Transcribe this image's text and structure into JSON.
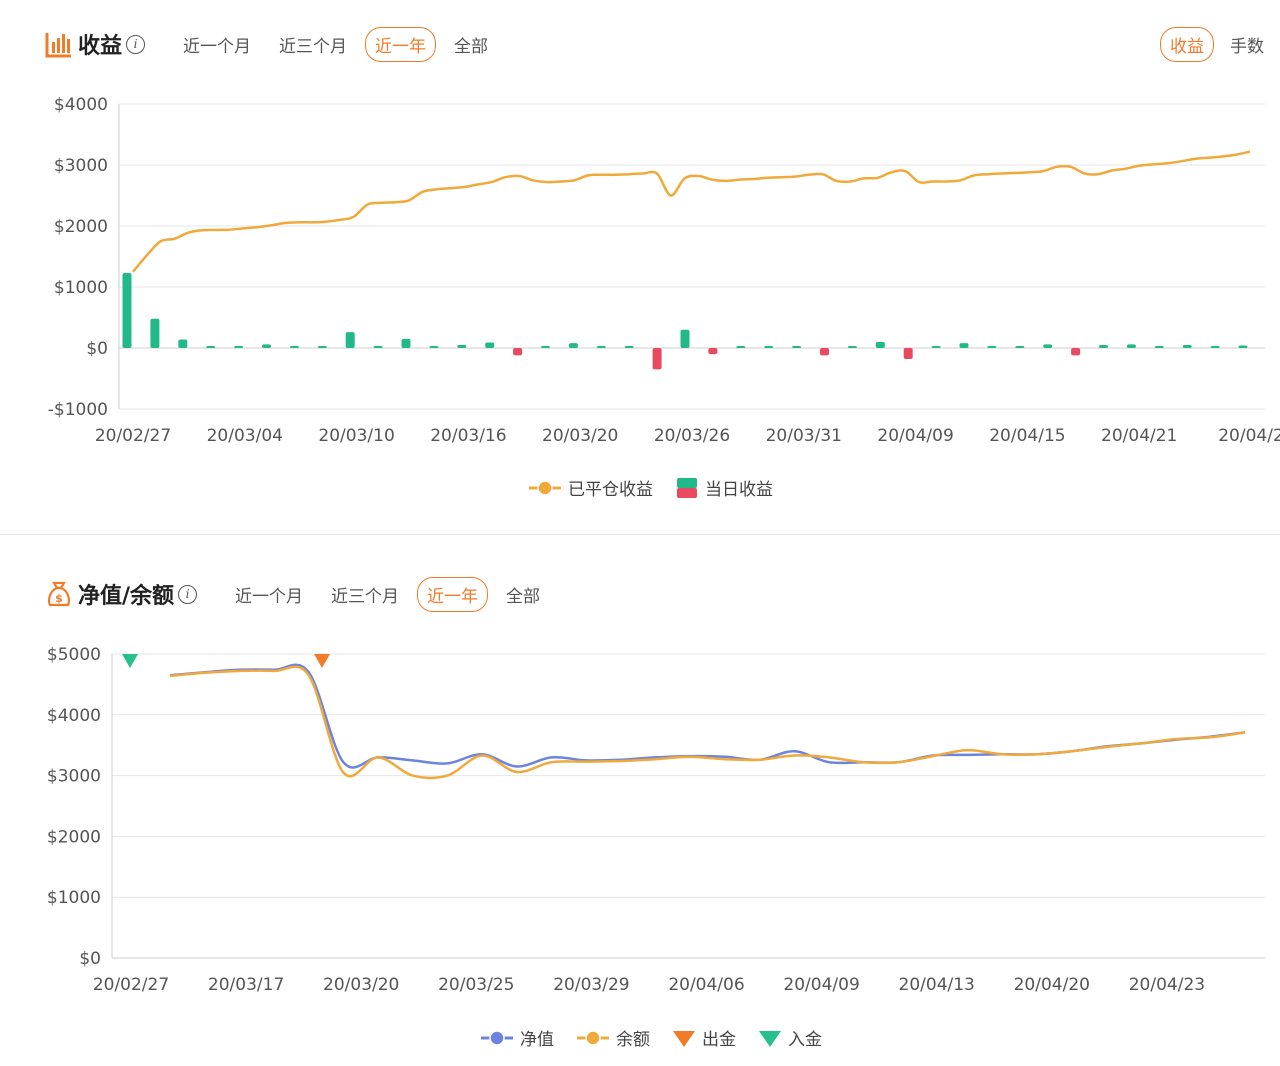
{
  "profit": {
    "title": "收益",
    "info": "i",
    "tabs": [
      {
        "label": "近一个月",
        "active": false
      },
      {
        "label": "近三个月",
        "active": false
      },
      {
        "label": "近一年",
        "active": true
      },
      {
        "label": "全部",
        "active": false
      }
    ],
    "mode_tabs": [
      {
        "label": "收益",
        "active": true
      },
      {
        "label": "手数",
        "active": false
      }
    ],
    "legend": [
      {
        "label": "已平仓收益",
        "type": "line",
        "color": "#f0a93a"
      },
      {
        "label": "当日收益",
        "type": "bar",
        "colors": [
          "#22b98a",
          "#e84a5f"
        ]
      }
    ]
  },
  "equity": {
    "title": "净值/余额",
    "info": "i",
    "tabs": [
      {
        "label": "近一个月",
        "active": false
      },
      {
        "label": "近三个月",
        "active": false
      },
      {
        "label": "近一年",
        "active": true
      },
      {
        "label": "全部",
        "active": false
      }
    ],
    "legend": [
      {
        "label": "净值",
        "type": "line",
        "color": "#6b84e0"
      },
      {
        "label": "余额",
        "type": "line",
        "color": "#f0a93a"
      },
      {
        "label": "出金",
        "type": "marker",
        "color": "#f07c2a"
      },
      {
        "label": "入金",
        "type": "marker",
        "color": "#26c08f"
      }
    ]
  },
  "colors": {
    "accent": "#f07c2a",
    "profit_line": "#f0a93a",
    "bar_positive": "#22b98a",
    "bar_negative": "#e84a5f",
    "equity_line": "#6b84e0",
    "balance_line": "#f0a93a",
    "deposit": "#26c08f",
    "withdraw": "#f07c2a",
    "grid": "#e6e6e6",
    "axis_text": "#555555"
  },
  "chart_data": [
    {
      "type": "bar+line",
      "title": "收益",
      "ylim": [
        -1000,
        4000
      ],
      "y_ticks": [
        4000,
        3000,
        2000,
        1000,
        0,
        -1000
      ],
      "y_tick_labels": [
        "$4000",
        "$3000",
        "$2000",
        "$1000",
        "$0",
        "-$1000"
      ],
      "x_tick_labels": [
        "20/02/27",
        "20/03/04",
        "20/03/10",
        "20/03/16",
        "20/03/20",
        "20/03/26",
        "20/03/31",
        "20/04/09",
        "20/04/15",
        "20/04/21",
        "20/04/2"
      ],
      "grid": true,
      "legend_position": "bottom",
      "series": [
        {
          "name": "已平仓收益",
          "kind": "line",
          "values": [
            1250,
            1520,
            1750,
            1790,
            1890,
            1930,
            1935,
            1940,
            1960,
            1980,
            2010,
            2050,
            2060,
            2060,
            2070,
            2100,
            2150,
            2350,
            2380,
            2390,
            2420,
            2560,
            2600,
            2620,
            2640,
            2680,
            2720,
            2800,
            2820,
            2750,
            2720,
            2730,
            2750,
            2830,
            2840,
            2840,
            2850,
            2860,
            2860,
            2500,
            2780,
            2820,
            2760,
            2740,
            2760,
            2770,
            2790,
            2800,
            2810,
            2840,
            2850,
            2740,
            2730,
            2780,
            2790,
            2880,
            2900,
            2720,
            2730,
            2730,
            2750,
            2830,
            2850,
            2860,
            2870,
            2880,
            2900,
            2970,
            2970,
            2860,
            2850,
            2910,
            2940,
            2990,
            3010,
            3030,
            3060,
            3100,
            3120,
            3140,
            3170,
            3220
          ]
        },
        {
          "name": "当日收益",
          "kind": "bar",
          "values": [
            1230,
            480,
            140,
            0,
            30,
            60,
            0,
            30,
            260,
            0,
            150,
            30,
            50,
            90,
            -120,
            0,
            80,
            0,
            20,
            -350,
            300,
            -100,
            30,
            10,
            30,
            -120,
            30,
            100,
            -180,
            10,
            80,
            10,
            10,
            60,
            -120,
            50,
            60,
            20,
            50,
            20,
            40
          ]
        }
      ]
    },
    {
      "type": "line",
      "title": "净值/余额",
      "ylim": [
        0,
        5000
      ],
      "y_ticks": [
        5000,
        4000,
        3000,
        2000,
        1000,
        0
      ],
      "y_tick_labels": [
        "$5000",
        "$4000",
        "$3000",
        "$2000",
        "$1000",
        "$0"
      ],
      "x_tick_labels": [
        "20/02/27",
        "20/03/17",
        "20/03/20",
        "20/03/25",
        "20/03/29",
        "20/04/06",
        "20/04/09",
        "20/04/13",
        "20/04/20",
        "20/04/23"
      ],
      "grid": true,
      "legend_position": "bottom",
      "series": [
        {
          "name": "净值",
          "kind": "line",
          "values": [
            4650,
            4700,
            4740,
            4740,
            4700,
            3220,
            3300,
            3250,
            3200,
            3350,
            3150,
            3300,
            3250,
            3260,
            3300,
            3320,
            3310,
            3260,
            3400,
            3220,
            3220,
            3220,
            3330,
            3340,
            3350,
            3350,
            3400,
            3480,
            3530,
            3590,
            3640,
            3710
          ]
        },
        {
          "name": "余额",
          "kind": "line",
          "values": [
            4640,
            4690,
            4720,
            4720,
            4650,
            3050,
            3300,
            3000,
            3000,
            3330,
            3060,
            3220,
            3230,
            3240,
            3270,
            3310,
            3270,
            3260,
            3330,
            3300,
            3220,
            3220,
            3320,
            3420,
            3350,
            3350,
            3400,
            3470,
            3530,
            3600,
            3630,
            3710
          ]
        }
      ],
      "markers": [
        {
          "name": "入金",
          "position_index": 0
        },
        {
          "name": "出金",
          "position_index": 5
        }
      ]
    }
  ]
}
